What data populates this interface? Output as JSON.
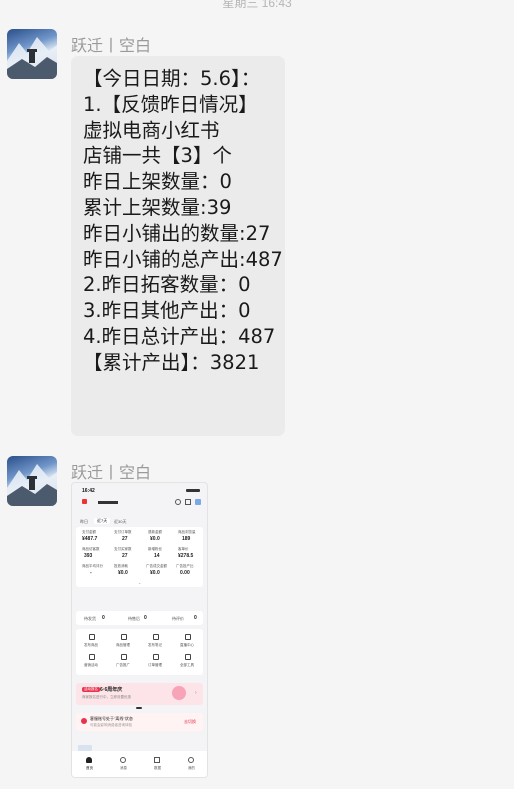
{
  "timestamp": "星期三 16:43",
  "messages": [
    {
      "sender": "跃迁丨空白",
      "lines": [
        "【今日日期：5.6】：",
        "1.【反馈昨日情况】",
        "虚拟电商小红书",
        "店铺一共【3】个",
        "昨日上架数量：0",
        "累计上架数量:39",
        "",
        "昨日小铺出的数量:27",
        "昨日小铺的总产出:487",
        "2.昨日拓客数量：0",
        "3.昨日其他产出：0",
        "4.昨日总计产出：487",
        "",
        "【累计产出】：3821"
      ]
    },
    {
      "sender": "跃迁丨空白",
      "image": {
        "status_time": "16:42",
        "tabs": [
          "昨日",
          "近7天",
          "近30天"
        ],
        "stats": [
          {
            "label": "支付金额",
            "value": "¥487.7"
          },
          {
            "label": "支付订单数",
            "value": "27"
          },
          {
            "label": "退款金额",
            "value": "¥0.0"
          },
          {
            "label": "商品浏览量",
            "value": "189"
          },
          {
            "label": "商品访客数",
            "value": "393"
          },
          {
            "label": "支付买家数",
            "value": "27"
          },
          {
            "label": "新增粉丝",
            "value": "14"
          },
          {
            "label": "客单价",
            "value": "¥278.5"
          },
          {
            "label": "商品平均评分",
            "value": "-"
          },
          {
            "label": "投放消耗",
            "value": "¥0.0"
          },
          {
            "label": "广告成交金额",
            "value": "¥0.0"
          },
          {
            "label": "广告投产比",
            "value": "0.00"
          }
        ],
        "order_counts": [
          {
            "label": "待发货",
            "value": "0"
          },
          {
            "label": "待售后",
            "value": "0"
          },
          {
            "label": "待评价",
            "value": "0"
          }
        ],
        "tools": [
          [
            "发布商品",
            "商品管理",
            "发布笔记",
            "直播中心"
          ],
          [
            "营销活动",
            "广告推广",
            "订单管理",
            "全部工具"
          ]
        ],
        "banner_tag": "活动报名",
        "banner_title": "6·6周年庆",
        "banner_sub": "商家报名进行中，立即设置优惠",
        "notice_title": "客服账号处于\"离线\"状态",
        "notice_sub": "可能会影响消费者咨询体验",
        "notice_action": "去切换",
        "bottom_nav": [
          "首页",
          "消息",
          "数据",
          "我的"
        ]
      }
    }
  ]
}
